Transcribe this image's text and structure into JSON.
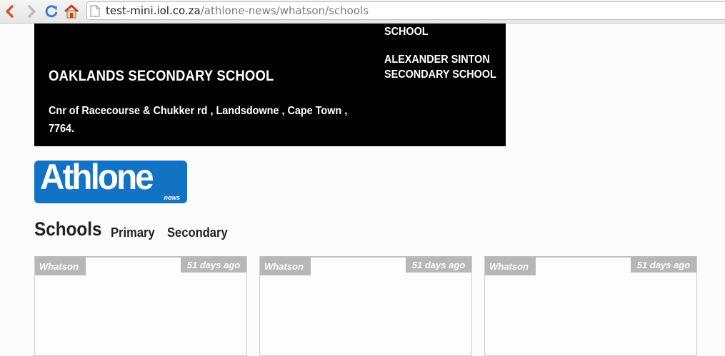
{
  "browser": {
    "url_host": "test-mini.iol.co.za",
    "url_path": "/athlone-news/whatson/schools"
  },
  "banner": {
    "title": "OAKLANDS SECONDARY SCHOOL",
    "address": "Cnr of Racecourse & Chukker rd , Landsdowne , Cape Town , 7764.",
    "related": [
      "SCHOOL",
      "ALEXANDER SINTON SECONDARY SCHOOL"
    ]
  },
  "logo": {
    "main": "Athlone",
    "sub": "news"
  },
  "page": {
    "heading": "Schools",
    "subnav": [
      "Primary",
      "Secondary"
    ]
  },
  "cards": [
    {
      "tag": "Whatson",
      "time": "51 days ago"
    },
    {
      "tag": "Whatson",
      "time": "51 days ago"
    },
    {
      "tag": "Whatson",
      "time": "51 days ago"
    }
  ],
  "colors": {
    "logo_blue": "#1273c4",
    "banner_bg": "#000000",
    "tag_gray": "#b7b7b7"
  }
}
